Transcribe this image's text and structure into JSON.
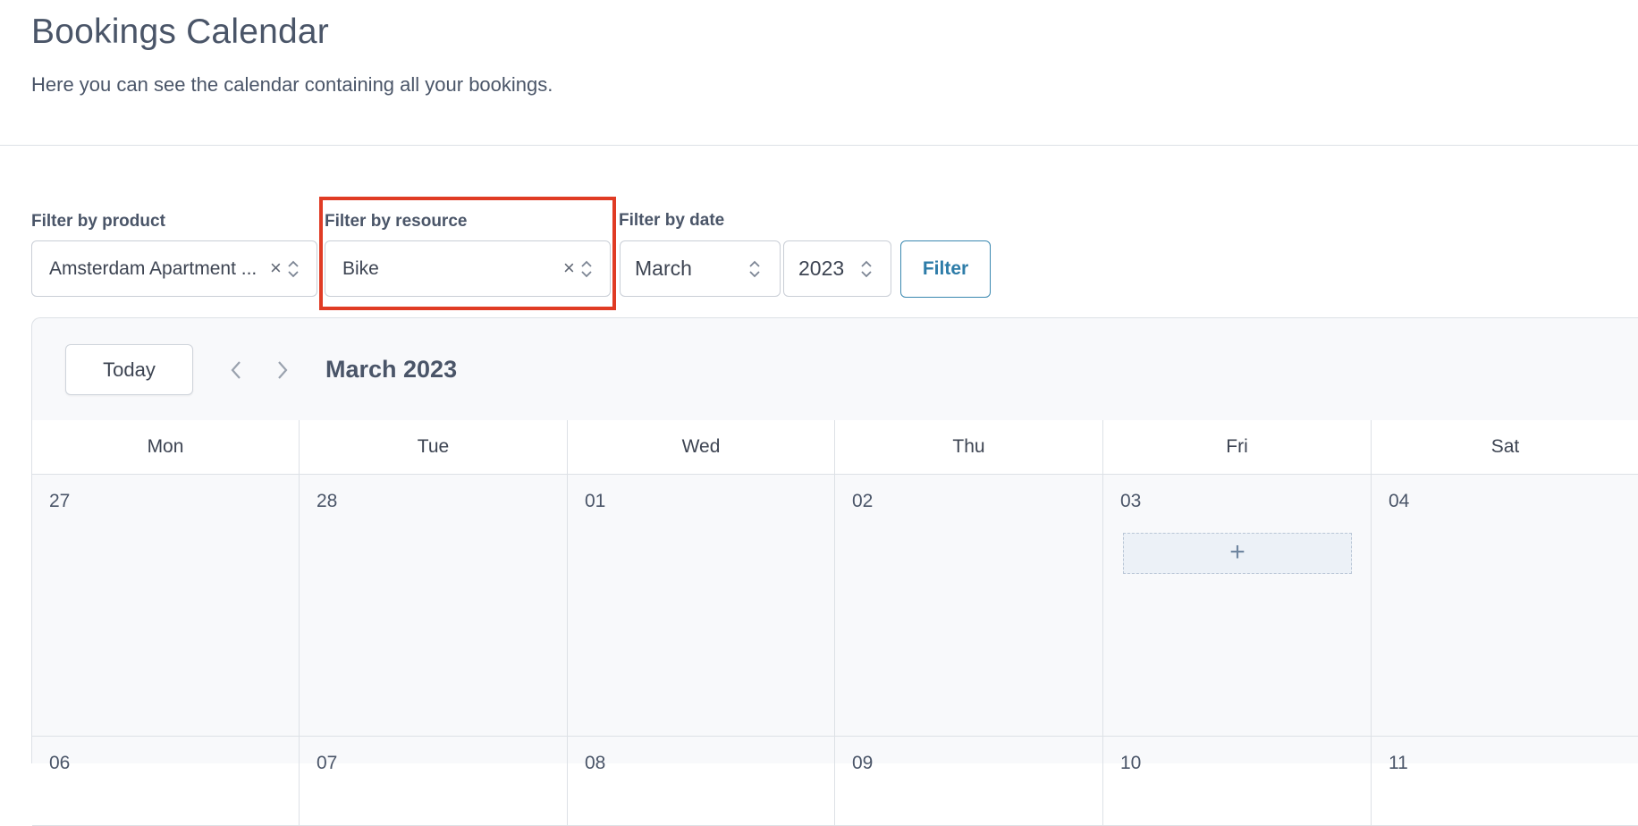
{
  "page": {
    "title": "Bookings Calendar",
    "subtitle": "Here you can see the calendar containing all your bookings."
  },
  "filters": {
    "product": {
      "label": "Filter by product",
      "value": "Amsterdam Apartment ...",
      "clear": "×"
    },
    "resource": {
      "label": "Filter by resource",
      "value": "Bike",
      "clear": "×"
    },
    "date": {
      "label": "Filter by date",
      "month": "March",
      "year": "2023"
    },
    "button_label": "Filter"
  },
  "calendar": {
    "today_label": "Today",
    "title": "March 2023",
    "weekdays": [
      "Mon",
      "Tue",
      "Wed",
      "Thu",
      "Fri",
      "Sat"
    ],
    "week1": [
      "27",
      "28",
      "01",
      "02",
      "03",
      "04"
    ],
    "week2": [
      "06",
      "07",
      "08",
      "09",
      "10",
      "11"
    ],
    "add_symbol": "+"
  },
  "colors": {
    "highlight": "#e03b24",
    "accent": "#2d7ca8"
  }
}
